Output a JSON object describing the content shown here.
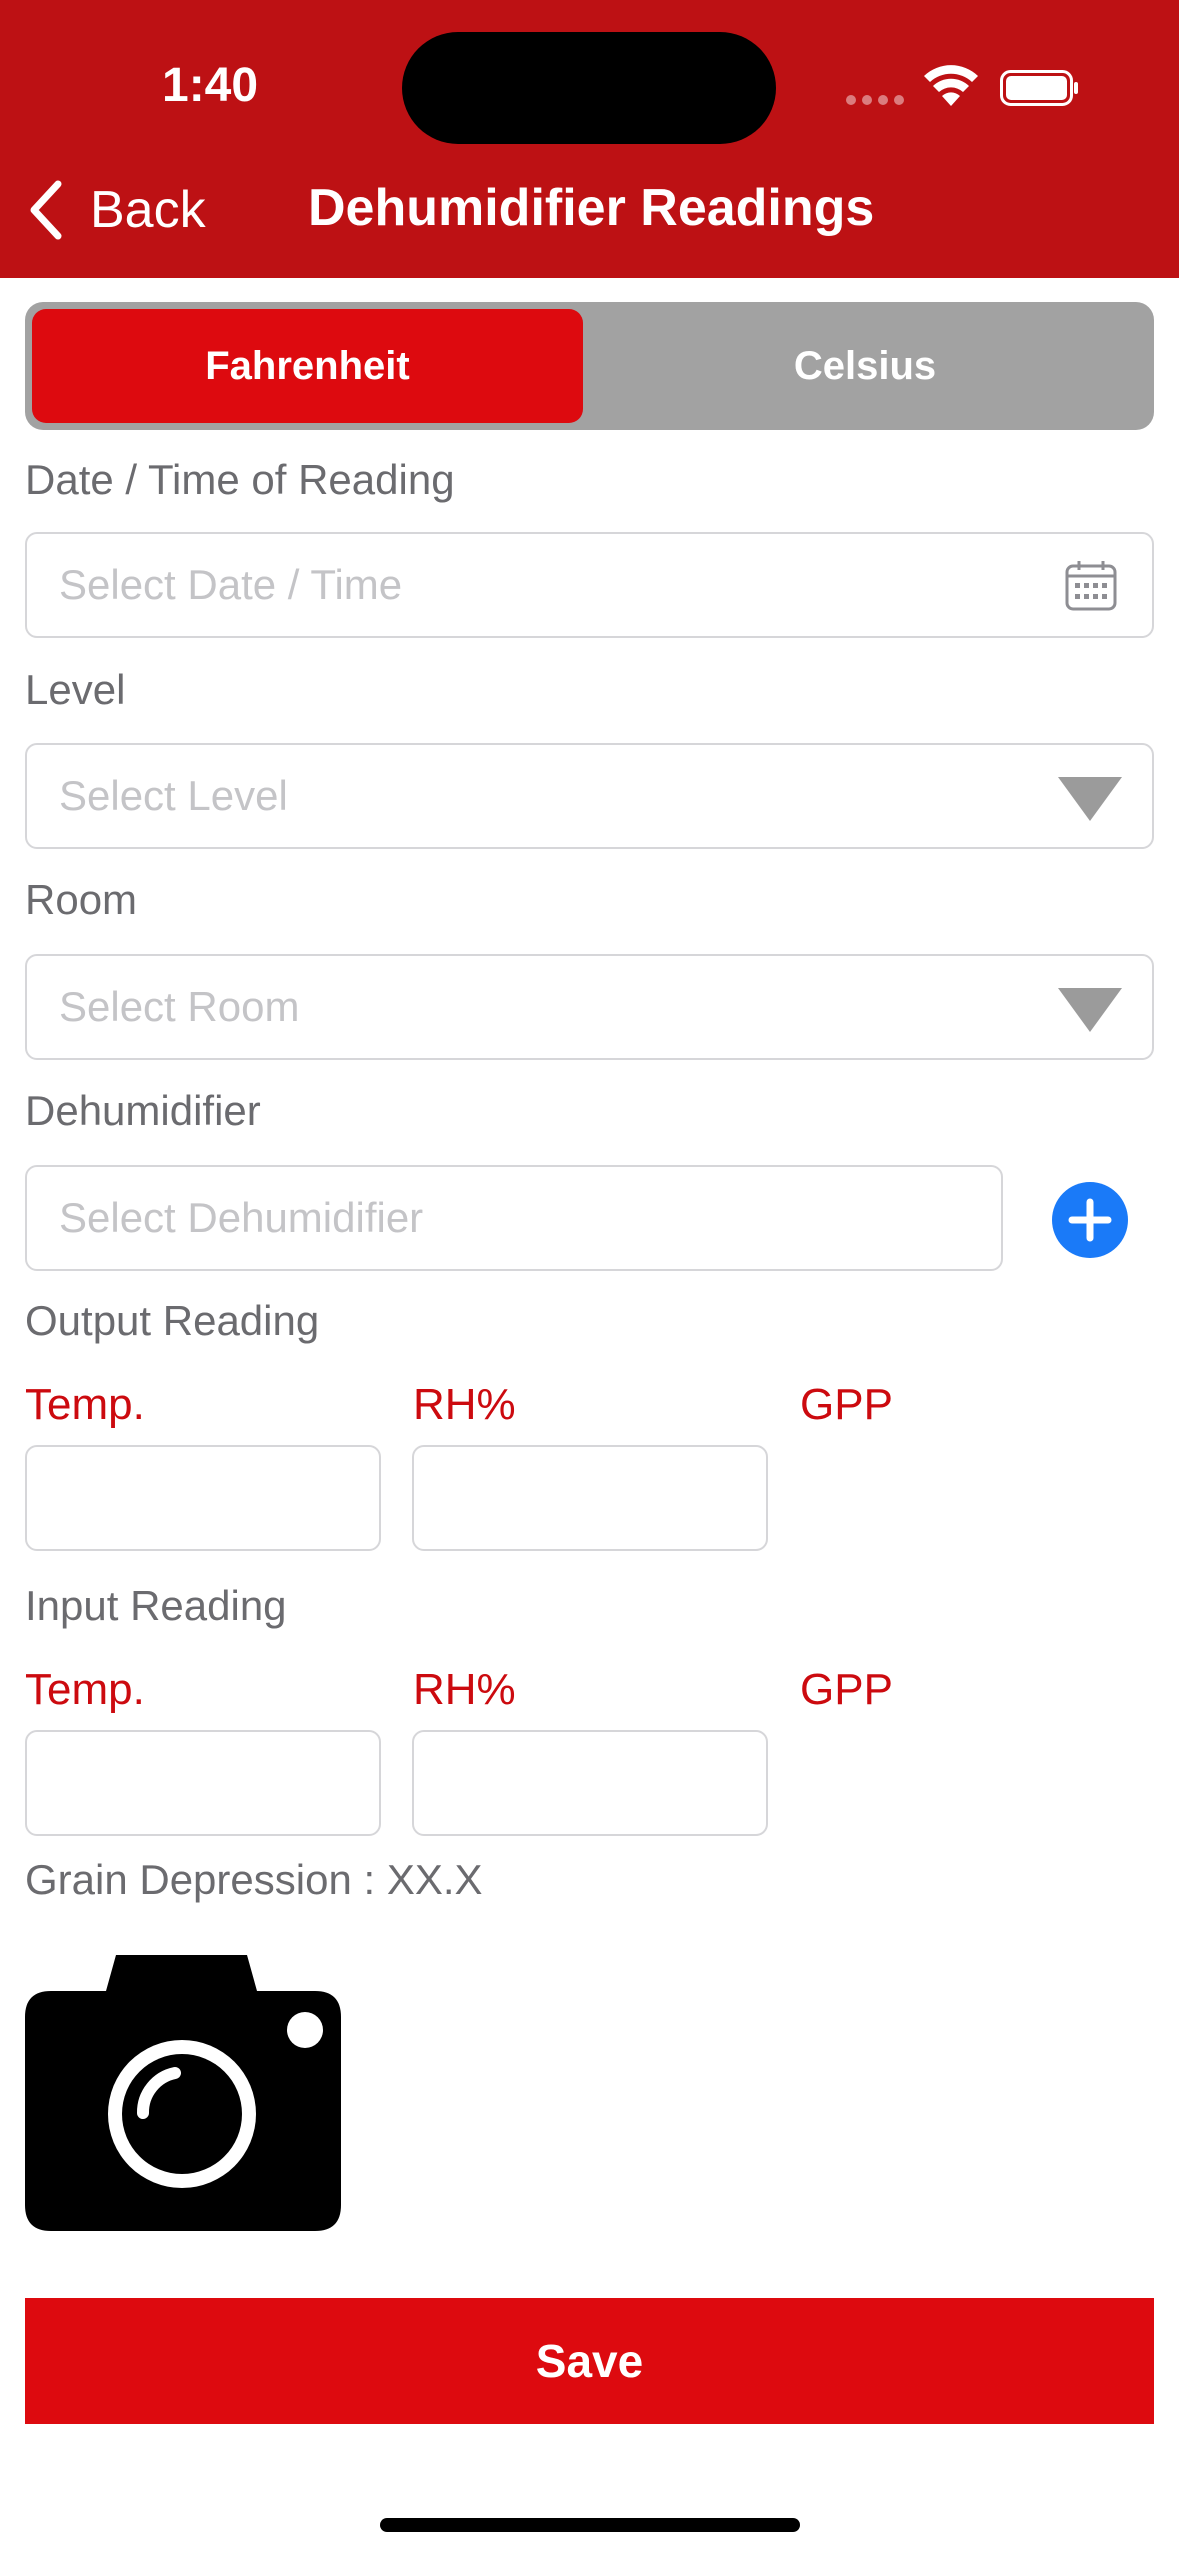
{
  "status_bar": {
    "time": "1:40"
  },
  "nav": {
    "back_label": "Back",
    "title": "Dehumidifier Readings"
  },
  "unit_toggle": {
    "options": [
      "Fahrenheit",
      "Celsius"
    ],
    "selected": "Fahrenheit"
  },
  "form": {
    "datetime": {
      "label": "Date / Time of Reading",
      "placeholder": "Select Date / Time",
      "icon": "calendar-icon"
    },
    "level": {
      "label": "Level",
      "placeholder": "Select Level",
      "icon": "dropdown-caret-icon"
    },
    "room": {
      "label": "Room",
      "placeholder": "Select Room",
      "icon": "dropdown-caret-icon"
    },
    "dehumidifier": {
      "label": "Dehumidifier",
      "placeholder": "Select Dehumidifier",
      "add_icon": "plus-circle-icon"
    },
    "output_reading": {
      "label": "Output Reading",
      "temp_label": "Temp.",
      "rh_label": "RH%",
      "gpp_label": "GPP",
      "temp_value": "",
      "rh_value": ""
    },
    "input_reading": {
      "label": "Input Reading",
      "temp_label": "Temp.",
      "rh_label": "RH%",
      "gpp_label": "GPP",
      "temp_value": "",
      "rh_value": ""
    },
    "grain_depression": "Grain Depression : XX.X"
  },
  "photo": {
    "icon": "camera-icon"
  },
  "save_label": "Save",
  "colors": {
    "header": "#bd1114",
    "accent_red": "#dd0a0f",
    "label_red": "#cc0a0f",
    "toggle_off": "#a2a2a2",
    "add_blue": "#1a7af8"
  }
}
